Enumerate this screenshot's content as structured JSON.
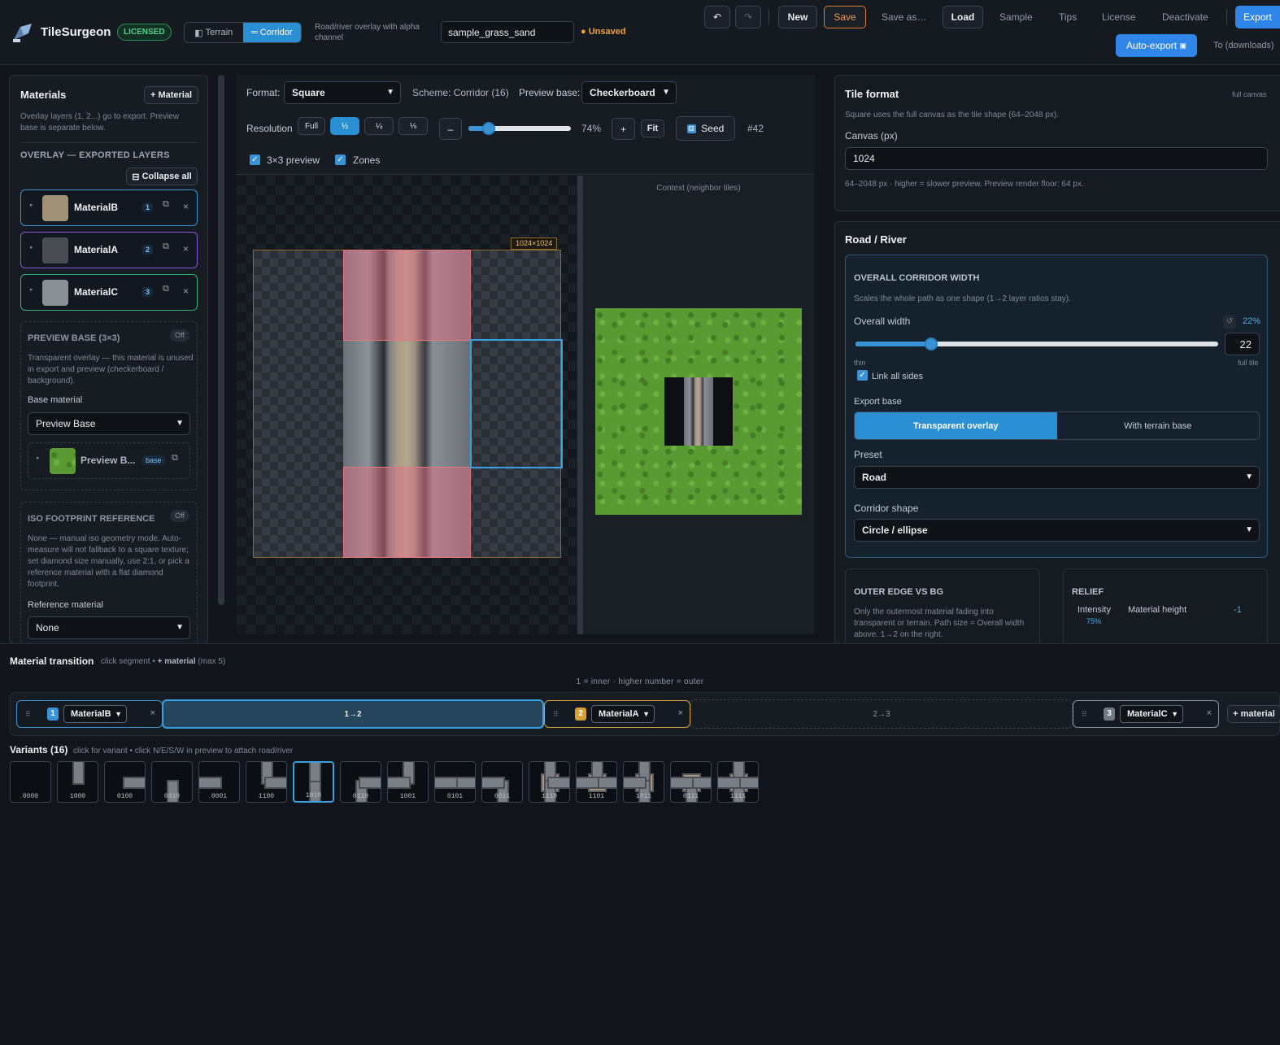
{
  "app": {
    "name": "TileSurgeon",
    "license_badge": "LICENSED"
  },
  "mode": {
    "terrain": "Terrain",
    "corridor": "Corridor",
    "description": "Road/river overlay with alpha channel"
  },
  "project": {
    "name": "sample_grass_sand",
    "status": "Unsaved"
  },
  "toolbar": {
    "undo": "↶",
    "redo": "↷",
    "new": "New",
    "save": "Save",
    "save_as": "Save as…",
    "load": "Load",
    "sample": "Sample",
    "tips": "Tips",
    "license": "License",
    "deactivate": "Deactivate",
    "export": "Export",
    "auto_export": "Auto-export",
    "to_downloads": "To (downloads)"
  },
  "materials_panel": {
    "title": "Materials",
    "add_button": "+ Material",
    "hint": "Overlay layers (1, 2...) go to export. Preview base is separate below.",
    "overlay_heading": "OVERLAY — EXPORTED LAYERS",
    "collapse_all": "Collapse all",
    "items": [
      {
        "name": "MaterialB",
        "index": "1",
        "border": "#3a93d6"
      },
      {
        "name": "MaterialA",
        "index": "2",
        "border": "#8a56d6"
      },
      {
        "name": "MaterialC",
        "index": "3",
        "border": "#2fb37a"
      }
    ],
    "preview_base": {
      "heading": "PREVIEW BASE (3×3)",
      "state": "Off",
      "text": "Transparent overlay — this material is unused in export and preview (checkerboard / background).",
      "base_label": "Base material",
      "base_value": "Preview Base",
      "item_name": "Preview B...",
      "item_tag": "base"
    },
    "iso": {
      "heading": "ISO FOOTPRINT REFERENCE",
      "state": "Off",
      "text": "None — manual iso geometry mode. Auto-measure will not fallback to a square texture; set diamond size manually, use 2:1, or pick a reference material with a flat diamond footprint.",
      "ref_label": "Reference material",
      "ref_value": "None"
    }
  },
  "preview_controls": {
    "format_label": "Format:",
    "format_value": "Square",
    "scheme": "Scheme: Corridor (16)",
    "preview_base_label": "Preview base:",
    "preview_base_value": "Checkerboard",
    "resolution_label": "Resolution",
    "res_options": [
      "Full",
      "½",
      "¼",
      "⅛"
    ],
    "res_selected": 1,
    "minus": "–",
    "zoom": "74%",
    "zoom_value": 0.74,
    "plus": "+",
    "fit": "Fit",
    "seed": "Seed",
    "seed_number": "#42",
    "grid_preview": "3×3 preview",
    "zones": "Zones",
    "tile_size": "1024×1024",
    "context_label": "Context (neighbor tiles)"
  },
  "tile_format": {
    "title": "Tile format",
    "tag": "full canvas",
    "desc": "Square uses the full canvas as the tile shape (64–2048 px).",
    "canvas_label": "Canvas (px)",
    "canvas_value": "1024",
    "note": "64–2048 px · higher = slower preview. Preview render floor: 64 px."
  },
  "road_river": {
    "title": "Road / River",
    "width_heading": "OVERALL CORRIDOR WIDTH",
    "width_desc": "Scales the whole path as one shape (1→2 layer ratios stay).",
    "overall_width_label": "Overall width",
    "overall_width_pct": "22%",
    "overall_width_value": "22",
    "overall_width_fraction": 0.22,
    "thin": "thin",
    "full_tile": "full tile",
    "link_all_sides": "Link all sides",
    "export_base_label": "Export base",
    "export_transparent": "Transparent overlay",
    "export_terrain": "With terrain base",
    "preset_label": "Preset",
    "preset_value": "Road",
    "shape_label": "Corridor shape",
    "shape_value": "Circle / ellipse",
    "outer_edge_heading": "OUTER EDGE VS BG",
    "outer_edge_desc": "Only the outermost material fading into transparent or terrain. Path size = Overall width above. 1→2 on the right.",
    "relief_heading": "RELIEF",
    "intensity_label": "Intensity",
    "intensity_value": "75%",
    "material_height_label": "Material height",
    "material_height_value": "-1"
  },
  "transition": {
    "title": "Material transition",
    "hint_pre": "click segment • ",
    "hint_bold": "+ material",
    "hint_post": " (max 5)",
    "order_note": "1 = inner · higher number = outer",
    "chips": [
      {
        "index": "1",
        "value": "MaterialB",
        "color": "#3a93d6"
      },
      {
        "index": "2",
        "value": "MaterialA",
        "color": "#d9a03a"
      },
      {
        "index": "3",
        "value": "MaterialC",
        "color": "#8b95a3"
      }
    ],
    "segments": [
      "1→2",
      "2→3"
    ],
    "add_material": "+ material"
  },
  "variants": {
    "title": "Variants (16)",
    "hint": "click for variant • click N/E/S/W in preview to attach road/river",
    "codes": [
      "0000",
      "1000",
      "0100",
      "0010",
      "0001",
      "1100",
      "1010",
      "0110",
      "1001",
      "0101",
      "0011",
      "1110",
      "1101",
      "1011",
      "0111",
      "1111"
    ],
    "selected": "1010"
  }
}
